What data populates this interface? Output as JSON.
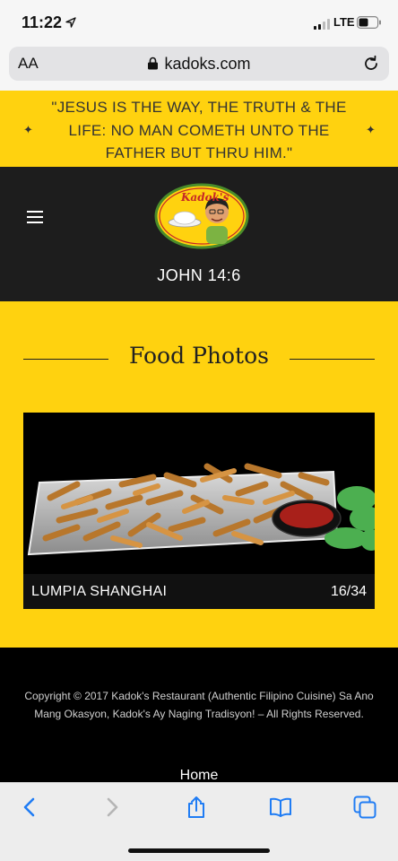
{
  "status_bar": {
    "time": "11:22",
    "network": "LTE"
  },
  "browser": {
    "text_size_label": "AA",
    "url": "kadoks.com"
  },
  "banner": {
    "quote": "\"JESUS IS THE WAY, THE TRUTH & THE LIFE: NO MAN COMETH UNTO THE FATHER BUT THRU HIM.\""
  },
  "header": {
    "logo_text": "Kadok's",
    "verse": "JOHN 14:6"
  },
  "main": {
    "section_title": "Food Photos",
    "photo": {
      "caption": "LUMPIA SHANGHAI",
      "counter": "16/34"
    }
  },
  "footer": {
    "copyright": "Copyright © 2017 Kadok's Restaurant (Authentic Filipino Cuisine) Sa Ano Mang Okasyon, Kadok's Ay Naging Tradisyon! – All Rights Reserved.",
    "home_link": "Home"
  },
  "toolbar": {
    "icons": [
      "back-icon",
      "forward-icon",
      "share-icon",
      "bookmarks-icon",
      "tabs-icon"
    ]
  },
  "colors": {
    "accent_yellow": "#ffd20f",
    "header_dark": "#1d1d1d",
    "ios_blue": "#1f7cf4"
  }
}
